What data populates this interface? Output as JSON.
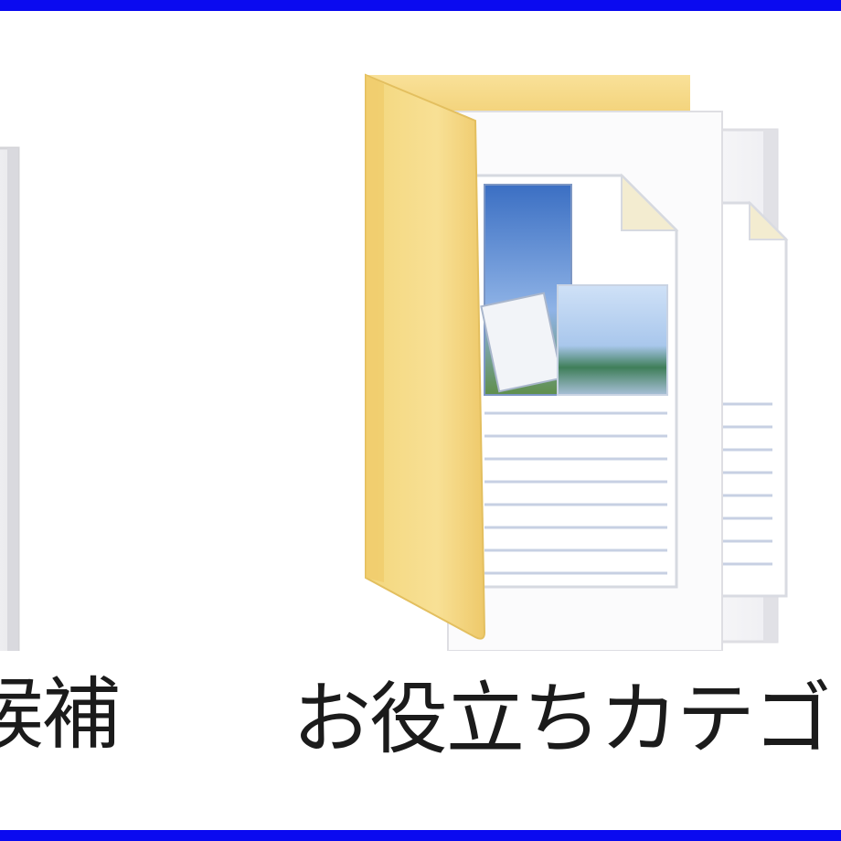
{
  "folders": [
    {
      "label": "候補",
      "icon": "folder-icon"
    },
    {
      "label": "お役立ちカテゴリー",
      "icon": "folder-documents-icon"
    }
  ],
  "colors": {
    "selection_border": "#0a0af0",
    "folder_yellow": "#f6d77f",
    "folder_yellow_dark": "#e8bd4f",
    "label_text": "#1b1b1b",
    "background": "#ffffff"
  }
}
